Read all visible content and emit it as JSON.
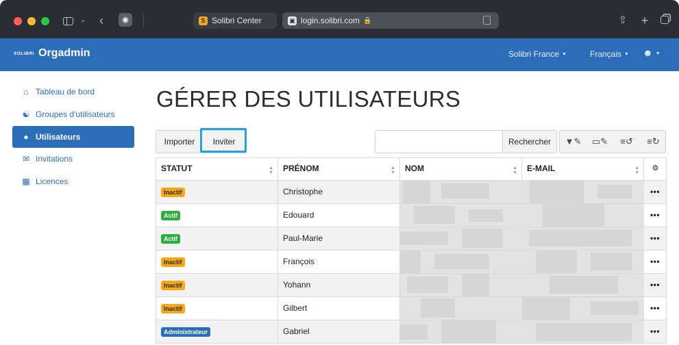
{
  "browser": {
    "tabs": [
      {
        "label": "Solibri Center",
        "favicon": "solibri-favicon"
      },
      {
        "label": "login.solibri.com",
        "favicon": "login-favicon",
        "secure": true
      }
    ]
  },
  "navbar": {
    "brand_small": "SOLIBRI",
    "brand_title": "Orgadmin",
    "organization": "Solibri France",
    "language": "Français",
    "user_icon": "user-circle-icon"
  },
  "sidebar": {
    "items": [
      {
        "label": "Tableau de bord",
        "icon": "home-icon",
        "active": false
      },
      {
        "label": "Groupes d'utilisateurs",
        "icon": "users-group-icon",
        "active": false
      },
      {
        "label": "Utilisateurs",
        "icon": "user-icon",
        "active": true
      },
      {
        "label": "Invitations",
        "icon": "envelope-icon",
        "active": false
      },
      {
        "label": "Licences",
        "icon": "licence-icon",
        "active": false
      }
    ]
  },
  "main": {
    "title": "GÉRER DES UTILISATEURS",
    "toolbar": {
      "import_label": "Importer",
      "invite_label": "Inviter",
      "search_value": "",
      "search_button": "Rechercher"
    },
    "table": {
      "headers": {
        "status": "STATUT",
        "firstname": "PRÉNOM",
        "lastname": "NOM",
        "email": "E-MAIL"
      },
      "rows": [
        {
          "status": "Inactif",
          "status_type": "inactive",
          "firstname": "Christophe",
          "actions": "•••"
        },
        {
          "status": "Actif",
          "status_type": "active",
          "firstname": "Edouard",
          "actions": "•••"
        },
        {
          "status": "Actif",
          "status_type": "active",
          "firstname": "Paul-Marie",
          "actions": "•••"
        },
        {
          "status": "Inactif",
          "status_type": "inactive",
          "firstname": "François",
          "actions": "•••"
        },
        {
          "status": "Inactif",
          "status_type": "inactive",
          "firstname": "Yohann",
          "actions": "•••"
        },
        {
          "status": "Inactif",
          "status_type": "inactive",
          "firstname": "Gilbert",
          "actions": "•••"
        },
        {
          "status": "Administrateur",
          "status_type": "admin",
          "firstname": "Gabriel",
          "actions": "•••"
        }
      ]
    }
  },
  "colors": {
    "primary": "#2b6db8",
    "inactive_badge": "#f6a81a",
    "active_badge": "#2fae3f",
    "highlight": "#1fa6dd"
  }
}
